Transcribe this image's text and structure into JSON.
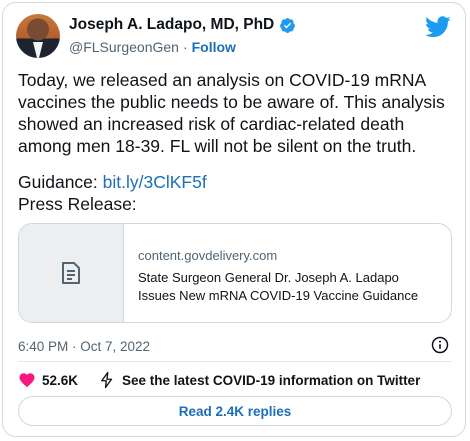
{
  "author": {
    "name": "Joseph A. Ladapo, MD, PhD",
    "handle": "@FLSurgeonGen",
    "separator": "·",
    "follow_label": "Follow"
  },
  "tweet": {
    "text": "Today, we released an analysis on COVID-19 mRNA vaccines the public needs to be aware of. This analysis showed an increased risk of cardiac-related death among men 18-39. FL will not be silent on the truth.",
    "guidance_label": "Guidance:",
    "guidance_link": "bit.ly/3ClKF5f",
    "press_label": "Press Release:"
  },
  "link_card": {
    "domain": "content.govdelivery.com",
    "title": "State Surgeon General Dr. Joseph A. Ladapo Issues New mRNA COVID-19 Vaccine Guidance"
  },
  "meta": {
    "timestamp": "6:40 PM · Oct 7, 2022"
  },
  "actions": {
    "likes": "52.6K",
    "covid_info": "See the latest COVID-19 information on Twitter"
  },
  "replies_button": "Read 2.4K replies",
  "colors": {
    "accent": "#1d6fb8",
    "like_heart": "#f91880",
    "verified": "#1d9bf0"
  },
  "icons": [
    "verified-badge-icon",
    "twitter-bird-icon",
    "document-icon",
    "info-icon",
    "heart-icon",
    "lightning-icon"
  ]
}
